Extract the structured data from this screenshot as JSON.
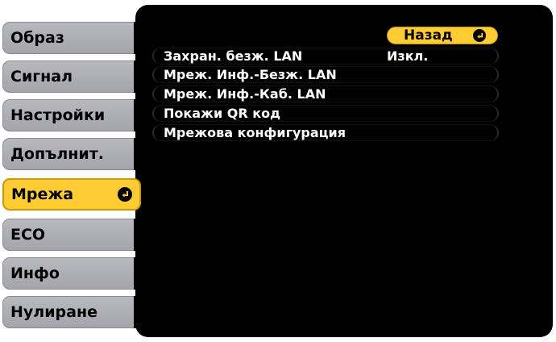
{
  "menu": {
    "items": [
      {
        "label": "Образ"
      },
      {
        "label": "Сигнал"
      },
      {
        "label": "Настройки"
      },
      {
        "label": "Допълнит."
      },
      {
        "label": "Мрежа"
      },
      {
        "label": "ECO"
      },
      {
        "label": "Инфо"
      },
      {
        "label": "Нулиране"
      }
    ],
    "active_index": 4
  },
  "back_button": {
    "label": "Назад"
  },
  "submenu": {
    "rows": [
      {
        "label": "Захран. безж. LAN",
        "value": "Изкл."
      },
      {
        "label": "Мреж. Инф.-Безж. LAN"
      },
      {
        "label": "Мреж. Инф.-Каб. LAN"
      },
      {
        "label": "Покажи QR код"
      },
      {
        "label": "Мрежова конфигурация"
      }
    ]
  },
  "colors": {
    "panel": "#000000",
    "tab": "#b0b0b8",
    "active": "#ffcc33",
    "text_on_panel": "#ffffff"
  },
  "icons": {
    "enter": "enter-icon"
  }
}
